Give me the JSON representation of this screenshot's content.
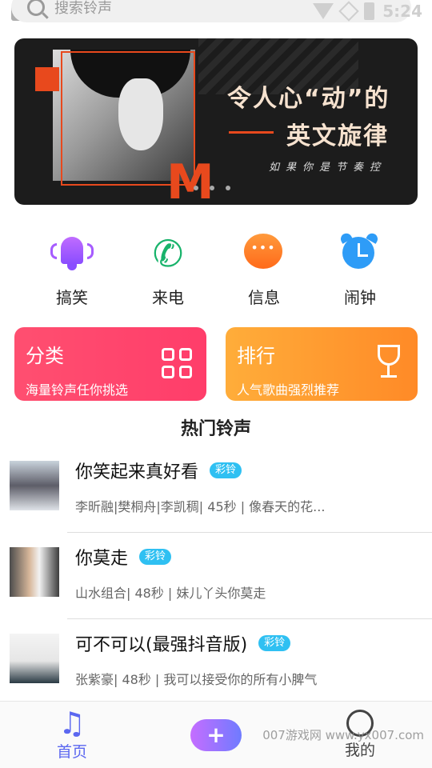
{
  "status_bar": {
    "time": "5:24"
  },
  "search": {
    "placeholder": "搜索铃声"
  },
  "banner": {
    "title_line1": "令人心“动”的",
    "title_line2": "英文旋律",
    "subtitle": "如果你是节奏控",
    "letter": "M"
  },
  "categories": [
    {
      "label": "搞笑",
      "icon": "bell-icon",
      "color": "#a65cff"
    },
    {
      "label": "来电",
      "icon": "phone-icon",
      "color": "#18b36b"
    },
    {
      "label": "信息",
      "icon": "message-icon",
      "color": "#ff7a22"
    },
    {
      "label": "闹钟",
      "icon": "alarm-clock-icon",
      "color": "#2e9cf7"
    }
  ],
  "feature_cards": [
    {
      "title": "分类",
      "subtitle": "海量铃声任你挑选",
      "icon": "grid-icon"
    },
    {
      "title": "排行",
      "subtitle": "人气歌曲强烈推荐",
      "icon": "trophy-icon"
    }
  ],
  "hot_section": {
    "title": "热门铃声"
  },
  "songs": [
    {
      "title": "你笑起来真好看",
      "tag": "彩铃",
      "meta": "李昕融|樊桐舟|李凯稠| 45秒 |  像春天的花..."
    },
    {
      "title": "你莫走",
      "tag": "彩铃",
      "meta": "山水组合| 48秒 |   妹儿丫头你莫走"
    },
    {
      "title": "可不可以(最强抖音版)",
      "tag": "彩铃",
      "meta": "张紫豪| 48秒 |   我可以接受你的所有小脾气"
    }
  ],
  "bottom_nav": {
    "home_label": "首页",
    "add_label": "+",
    "me_label": "我的"
  },
  "watermark": "007游戏网 www.yx007.com",
  "colors": {
    "accent": "#5b67f0",
    "tag": "#2fc0f2",
    "card_red": "#ff4f70",
    "card_orange": "#ff8a27"
  }
}
